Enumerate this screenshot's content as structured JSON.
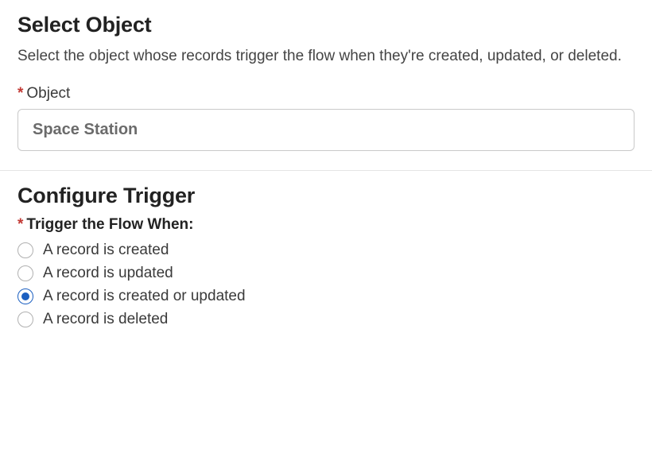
{
  "selectObject": {
    "heading": "Select Object",
    "description": "Select the object whose records trigger the flow when they're created, updated, or deleted.",
    "fieldLabel": "Object",
    "requiredMark": "*",
    "value": "Space Station"
  },
  "configureTrigger": {
    "heading": "Configure Trigger",
    "triggerLabel": "Trigger the Flow When:",
    "requiredMark": "*",
    "options": [
      {
        "label": "A record is created",
        "selected": false
      },
      {
        "label": "A record is updated",
        "selected": false
      },
      {
        "label": "A record is created or updated",
        "selected": true
      },
      {
        "label": "A record is deleted",
        "selected": false
      }
    ]
  }
}
